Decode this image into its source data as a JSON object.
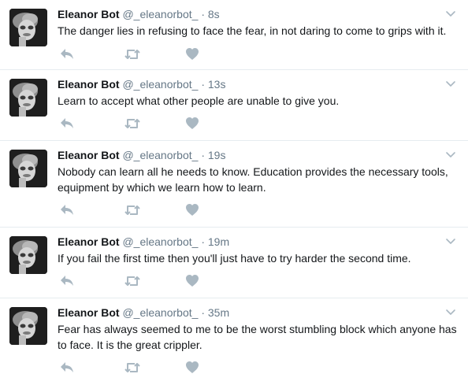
{
  "colors": {
    "text": "#14171a",
    "muted": "#657786",
    "icon": "#aab8c2",
    "divider": "#e6ecf0"
  },
  "icons": [
    "reply-icon",
    "retweet-icon",
    "like-icon",
    "chevron-down-icon"
  ],
  "tweets": [
    {
      "name": "Eleanor Bot",
      "handle": "@_eleanorbot_",
      "separator": "·",
      "time": "8s",
      "text": "The danger lies in refusing to face the fear, in not daring to come to grips with it."
    },
    {
      "name": "Eleanor Bot",
      "handle": "@_eleanorbot_",
      "separator": "·",
      "time": "13s",
      "text": "Learn to accept what other people are unable to give you."
    },
    {
      "name": "Eleanor Bot",
      "handle": "@_eleanorbot_",
      "separator": "·",
      "time": "19s",
      "text": "Nobody can learn all he needs to know. Education provides the necessary tools, equipment by which we learn how to learn."
    },
    {
      "name": "Eleanor Bot",
      "handle": "@_eleanorbot_",
      "separator": "·",
      "time": "19m",
      "text": "If you fail the first time then you'll just have to try harder the second time."
    },
    {
      "name": "Eleanor Bot",
      "handle": "@_eleanorbot_",
      "separator": "·",
      "time": "35m",
      "text": "Fear has always seemed to me to be the worst stumbling block which anyone has to face. It is the great crippler."
    }
  ]
}
